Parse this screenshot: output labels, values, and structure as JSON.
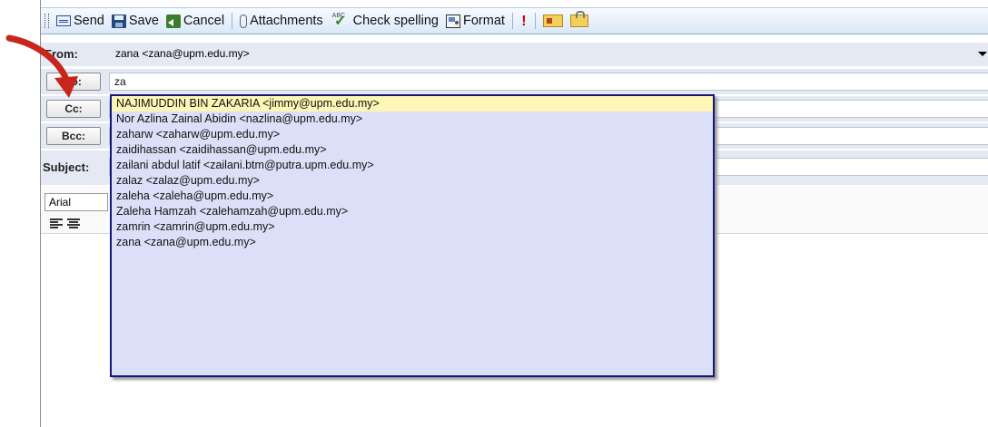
{
  "toolbar": {
    "send": "Send",
    "save": "Save",
    "cancel": "Cancel",
    "attachments": "Attachments",
    "check_spelling": "Check spelling",
    "format": "Format"
  },
  "from": {
    "label": "From:",
    "value": "zana <zana@upm.edu.my>"
  },
  "to": {
    "label": "To:",
    "value": "za"
  },
  "cc": {
    "label": "Cc:"
  },
  "bcc": {
    "label": "Bcc:"
  },
  "subject": {
    "label": "Subject:"
  },
  "editor": {
    "font": "Arial"
  },
  "autocomplete": {
    "items": [
      "NAJIMUDDIN BIN ZAKARIA <jimmy@upm.edu.my>",
      "Nor Azlina Zainal Abidin <nazlina@upm.edu.my>",
      "zaharw <zaharw@upm.edu.my>",
      "zaidihassan <zaidihassan@upm.edu.my>",
      "zailani abdul latif <zailani.btm@putra.upm.edu.my>",
      "zalaz <zalaz@upm.edu.my>",
      "zaleha <zaleha@upm.edu.my>",
      "Zaleha Hamzah <zalehamzah@upm.edu.my>",
      "zamrin <zamrin@upm.edu.my>",
      "zana <zana@upm.edu.my>"
    ]
  },
  "colors": {
    "arrow": "#c8261d",
    "dropdown_border": "#15157a",
    "dropdown_bg": "#dcdff8",
    "highlight": "#fdf6b4"
  }
}
